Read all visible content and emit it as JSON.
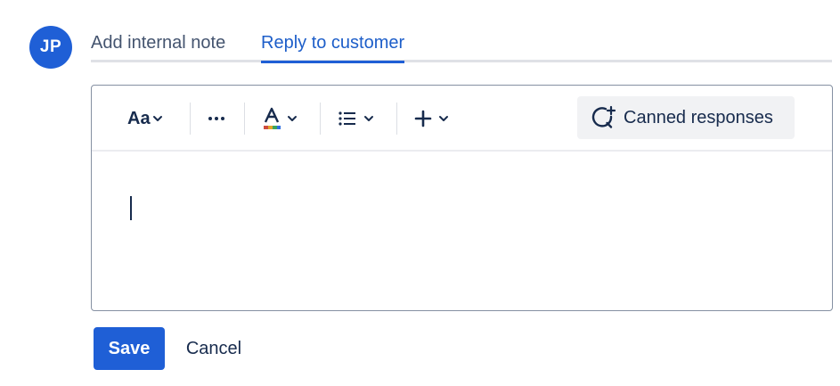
{
  "avatar": {
    "initials": "JP",
    "color": "#1f5fd6"
  },
  "tabs": [
    {
      "label": "Add internal note",
      "active": false
    },
    {
      "label": "Reply to customer",
      "active": true
    }
  ],
  "toolbar": {
    "text_style_label": "Aa",
    "text_style_icon": "chevron-down-icon",
    "more_formatting_icon": "more-horizontal-icon",
    "text_color_icon": "text-color-icon",
    "list_icon": "bullet-list-icon",
    "insert_icon": "plus-icon",
    "canned_responses_label": "Canned responses",
    "canned_responses_icon": "comment-add-icon"
  },
  "editor": {
    "value": ""
  },
  "actions": {
    "save_label": "Save",
    "cancel_label": "Cancel"
  },
  "colors": {
    "accent": "#1f5fd6",
    "text": "#172b4d",
    "muted": "#44546f"
  }
}
